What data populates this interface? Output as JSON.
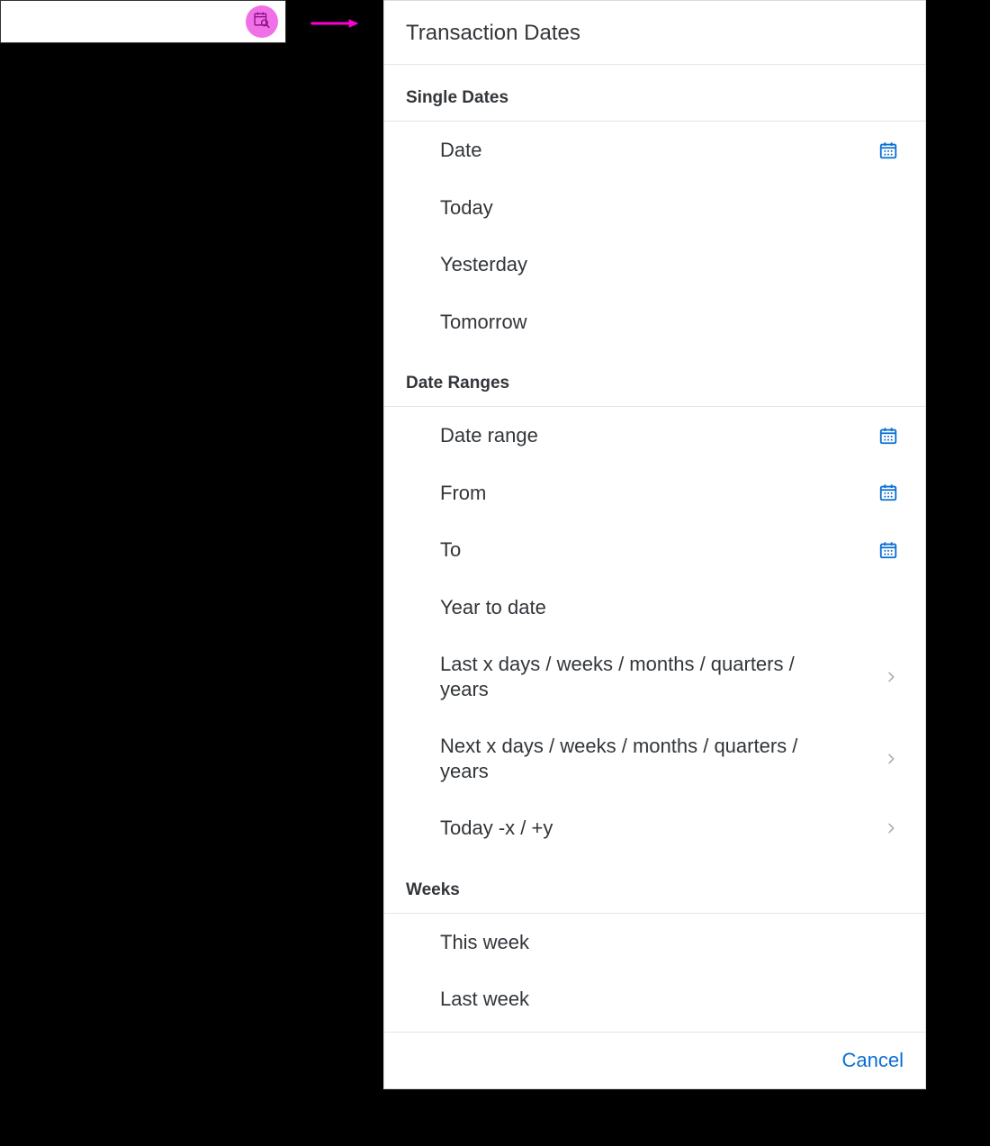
{
  "input": {
    "value": "",
    "icon": "calendar-search-icon"
  },
  "panel": {
    "title": "Transaction Dates",
    "sections": {
      "single_dates": {
        "header": "Single Dates",
        "items": {
          "date": {
            "label": "Date",
            "has_calendar": true,
            "has_chevron": false
          },
          "today": {
            "label": "Today",
            "has_calendar": false,
            "has_chevron": false
          },
          "yesterday": {
            "label": "Yesterday",
            "has_calendar": false,
            "has_chevron": false
          },
          "tomorrow": {
            "label": "Tomorrow",
            "has_calendar": false,
            "has_chevron": false
          }
        }
      },
      "date_ranges": {
        "header": "Date Ranges",
        "items": {
          "date_range": {
            "label": "Date range",
            "has_calendar": true,
            "has_chevron": false
          },
          "from": {
            "label": "From",
            "has_calendar": true,
            "has_chevron": false
          },
          "to": {
            "label": "To",
            "has_calendar": true,
            "has_chevron": false
          },
          "year_to_date": {
            "label": "Year to date",
            "has_calendar": false,
            "has_chevron": false
          },
          "last_x": {
            "label": "Last x days / weeks / months / quarters / years",
            "has_calendar": false,
            "has_chevron": true
          },
          "next_x": {
            "label": "Next x days / weeks / months / quarters / years",
            "has_calendar": false,
            "has_chevron": true
          },
          "today_xy": {
            "label": "Today -x / +y",
            "has_calendar": false,
            "has_chevron": true
          }
        }
      },
      "weeks": {
        "header": "Weeks",
        "items": {
          "this_week": {
            "label": "This week",
            "has_calendar": false,
            "has_chevron": false
          },
          "last_week": {
            "label": "Last week",
            "has_calendar": false,
            "has_chevron": false
          }
        }
      }
    },
    "footer": {
      "cancel": "Cancel"
    }
  },
  "colors": {
    "accent": "#0a6ed1",
    "highlight": "#f070e8",
    "text": "#32363a"
  }
}
